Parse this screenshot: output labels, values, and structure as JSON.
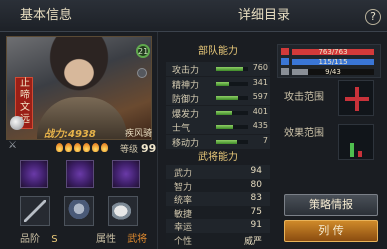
{
  "header": {
    "left_title": "基本信息",
    "right_title": "详细目录",
    "help_label": "?"
  },
  "hero": {
    "name": "止啼文远",
    "level_badge": "21",
    "power_label": "战力:",
    "power_value": "4938",
    "troop_type": "疾风骑",
    "star_count": 6,
    "level_label": "等级",
    "level_value": "99"
  },
  "bottom": {
    "grade_label": "品阶",
    "grade_value": "S",
    "attribute_label": "属性",
    "attribute_value": "武将"
  },
  "troop_panel": {
    "title": "部队能力",
    "stats": [
      {
        "label": "攻击力",
        "value": "760",
        "fill": 0.85
      },
      {
        "label": "精神力",
        "value": "341",
        "fill": 0.42
      },
      {
        "label": "防御力",
        "value": "597",
        "fill": 0.7
      },
      {
        "label": "爆发力",
        "value": "401",
        "fill": 0.5
      },
      {
        "label": "士气",
        "value": "435",
        "fill": 0.52
      },
      {
        "label": "移动力",
        "value": "7",
        "fill": 0.65
      }
    ]
  },
  "general_panel": {
    "title": "武将能力",
    "stats": [
      {
        "label": "武力",
        "value": "94"
      },
      {
        "label": "智力",
        "value": "80"
      },
      {
        "label": "统率",
        "value": "83"
      },
      {
        "label": "敏捷",
        "value": "75"
      },
      {
        "label": "幸运",
        "value": "91"
      },
      {
        "label": "个性",
        "value": "威严"
      }
    ]
  },
  "resources": [
    {
      "name": "hp",
      "text": "763/763",
      "color": "#d23a3a",
      "fill": 1.0
    },
    {
      "name": "mp",
      "text": "115/115",
      "color": "#3a76d6",
      "fill": 1.0
    },
    {
      "name": "exp",
      "text": "9/43",
      "color": "#8a8f97",
      "fill": 0.2
    }
  ],
  "ranges": {
    "attack_label": "攻击范围",
    "effect_label": "效果范围"
  },
  "buttons": {
    "strategy": "策略情报",
    "biography": "列 传"
  },
  "colors": {
    "accent_gold": "#e8c879",
    "bar_green": "#6cbf45",
    "attribute_orange": "#e08a2e"
  },
  "icons": [
    "sword-icon",
    "star-flame-icon",
    "help-icon"
  ]
}
